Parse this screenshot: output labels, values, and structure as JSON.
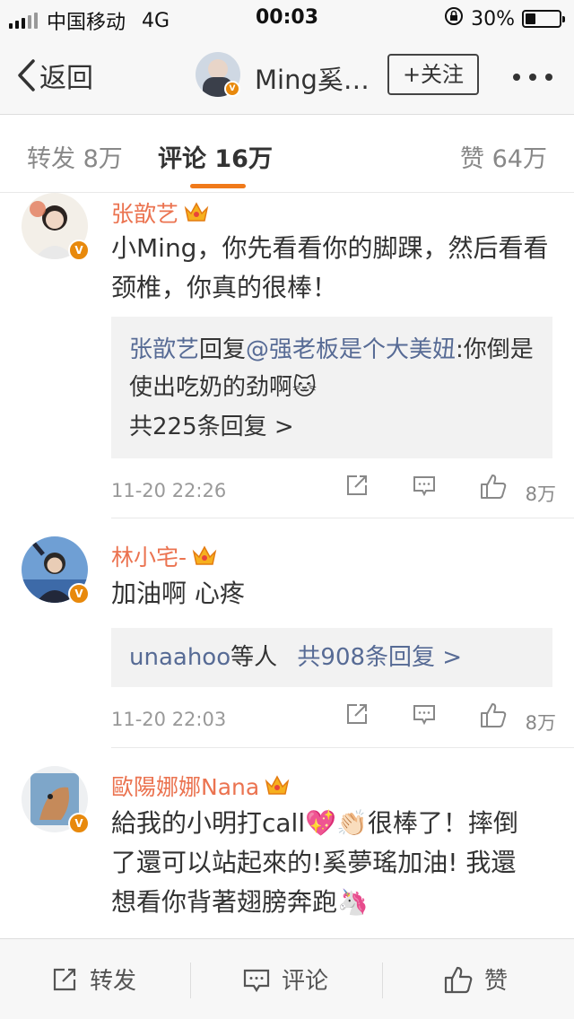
{
  "status_bar": {
    "carrier": "中国移动",
    "network": "4G",
    "time": "00:03",
    "battery": "30%",
    "battery_level": 0.3
  },
  "nav": {
    "back_label": "返回",
    "title": "Ming奚…",
    "follow_label": "+关注"
  },
  "tabs": [
    {
      "label": "转发 8万",
      "active": false
    },
    {
      "label": "评论 16万",
      "active": true
    },
    {
      "label": "赞 64万",
      "active": false
    }
  ],
  "comments": [
    {
      "author": "张歆艺",
      "text": "小Ming，你先看看你的脚踝，然后看看颈椎，你真的很棒！",
      "reply_author": "张歆艺",
      "reply_verb": "回复",
      "reply_mention": "@强老板是个大美妞",
      "reply_text": ":你倒是使出吃奶的劲啊",
      "reply_emoji": "🐱",
      "reply_count_label": "共225条回复 >",
      "date": "11-20 22:26",
      "likes": "8万"
    },
    {
      "author": "林小宅-",
      "text": "加油啊 心疼",
      "reply_summary_user": "unaahoo",
      "reply_summary_mid": "等人",
      "reply_count_label": "共908条回复 >",
      "date": "11-20 22:03",
      "likes": "8万"
    },
    {
      "author": "歐陽娜娜Nana",
      "text_line1": "給我的小明打call💖👏🏻很棒了！摔倒",
      "text_line2": "了還可以站起來的!奚夢瑤加油! 我還",
      "text_line3": "想看你背著翅膀奔跑🦄"
    }
  ],
  "bottom_bar": {
    "repost_label": "转发",
    "comment_label": "评论",
    "like_label": "赞"
  },
  "colors": {
    "accent": "#f07a1a",
    "author": "#eb7350",
    "link": "#576b95",
    "badge": "#e8890c"
  }
}
